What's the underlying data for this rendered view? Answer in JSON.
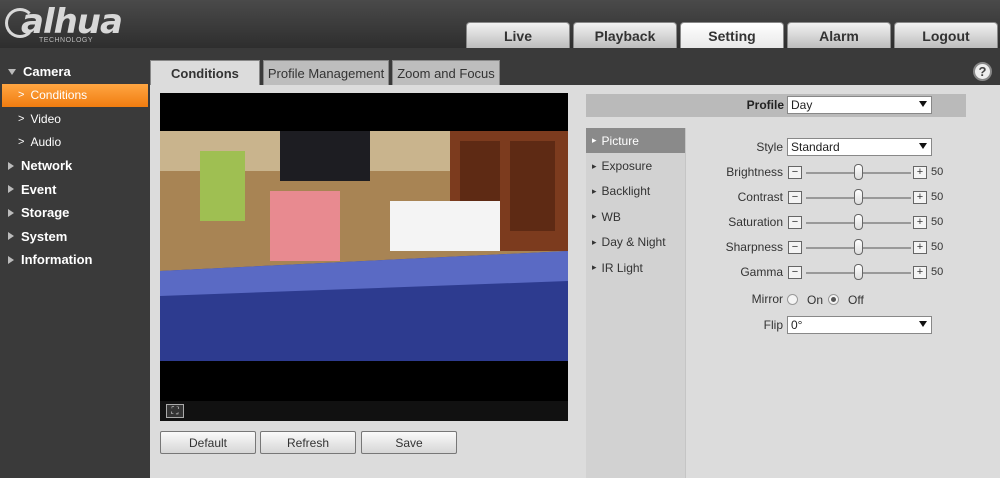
{
  "logo": {
    "brand": "alhua",
    "sub": "TECHNOLOGY"
  },
  "nav": {
    "tabs": [
      {
        "label": "Live"
      },
      {
        "label": "Playback"
      },
      {
        "label": "Setting",
        "active": true
      },
      {
        "label": "Alarm"
      },
      {
        "label": "Logout"
      }
    ]
  },
  "sidebar": {
    "camera": "Camera",
    "conditions": "Conditions",
    "video": "Video",
    "audio": "Audio",
    "network": "Network",
    "event": "Event",
    "storage": "Storage",
    "system": "System",
    "information": "Information"
  },
  "subtabs": {
    "conditions": "Conditions",
    "profile_management": "Profile Management",
    "zoom_focus": "Zoom and Focus"
  },
  "help": "?",
  "buttons": {
    "default": "Default",
    "refresh": "Refresh",
    "save": "Save"
  },
  "profile": {
    "label": "Profile",
    "value": "Day"
  },
  "submenu": {
    "picture": "Picture",
    "exposure": "Exposure",
    "backlight": "Backlight",
    "wb": "WB",
    "day_night": "Day & Night",
    "ir_light": "IR Light"
  },
  "form": {
    "style_label": "Style",
    "style_value": "Standard",
    "brightness_label": "Brightness",
    "brightness_value": "50",
    "contrast_label": "Contrast",
    "contrast_value": "50",
    "saturation_label": "Saturation",
    "saturation_value": "50",
    "sharpness_label": "Sharpness",
    "sharpness_value": "50",
    "gamma_label": "Gamma",
    "gamma_value": "50",
    "mirror_label": "Mirror",
    "mirror_on": "On",
    "mirror_off": "Off",
    "flip_label": "Flip",
    "flip_value": "0°"
  },
  "colors": {
    "accent": "#f7901e",
    "header": "#3a3a3a",
    "panel": "#dcdcdc"
  }
}
